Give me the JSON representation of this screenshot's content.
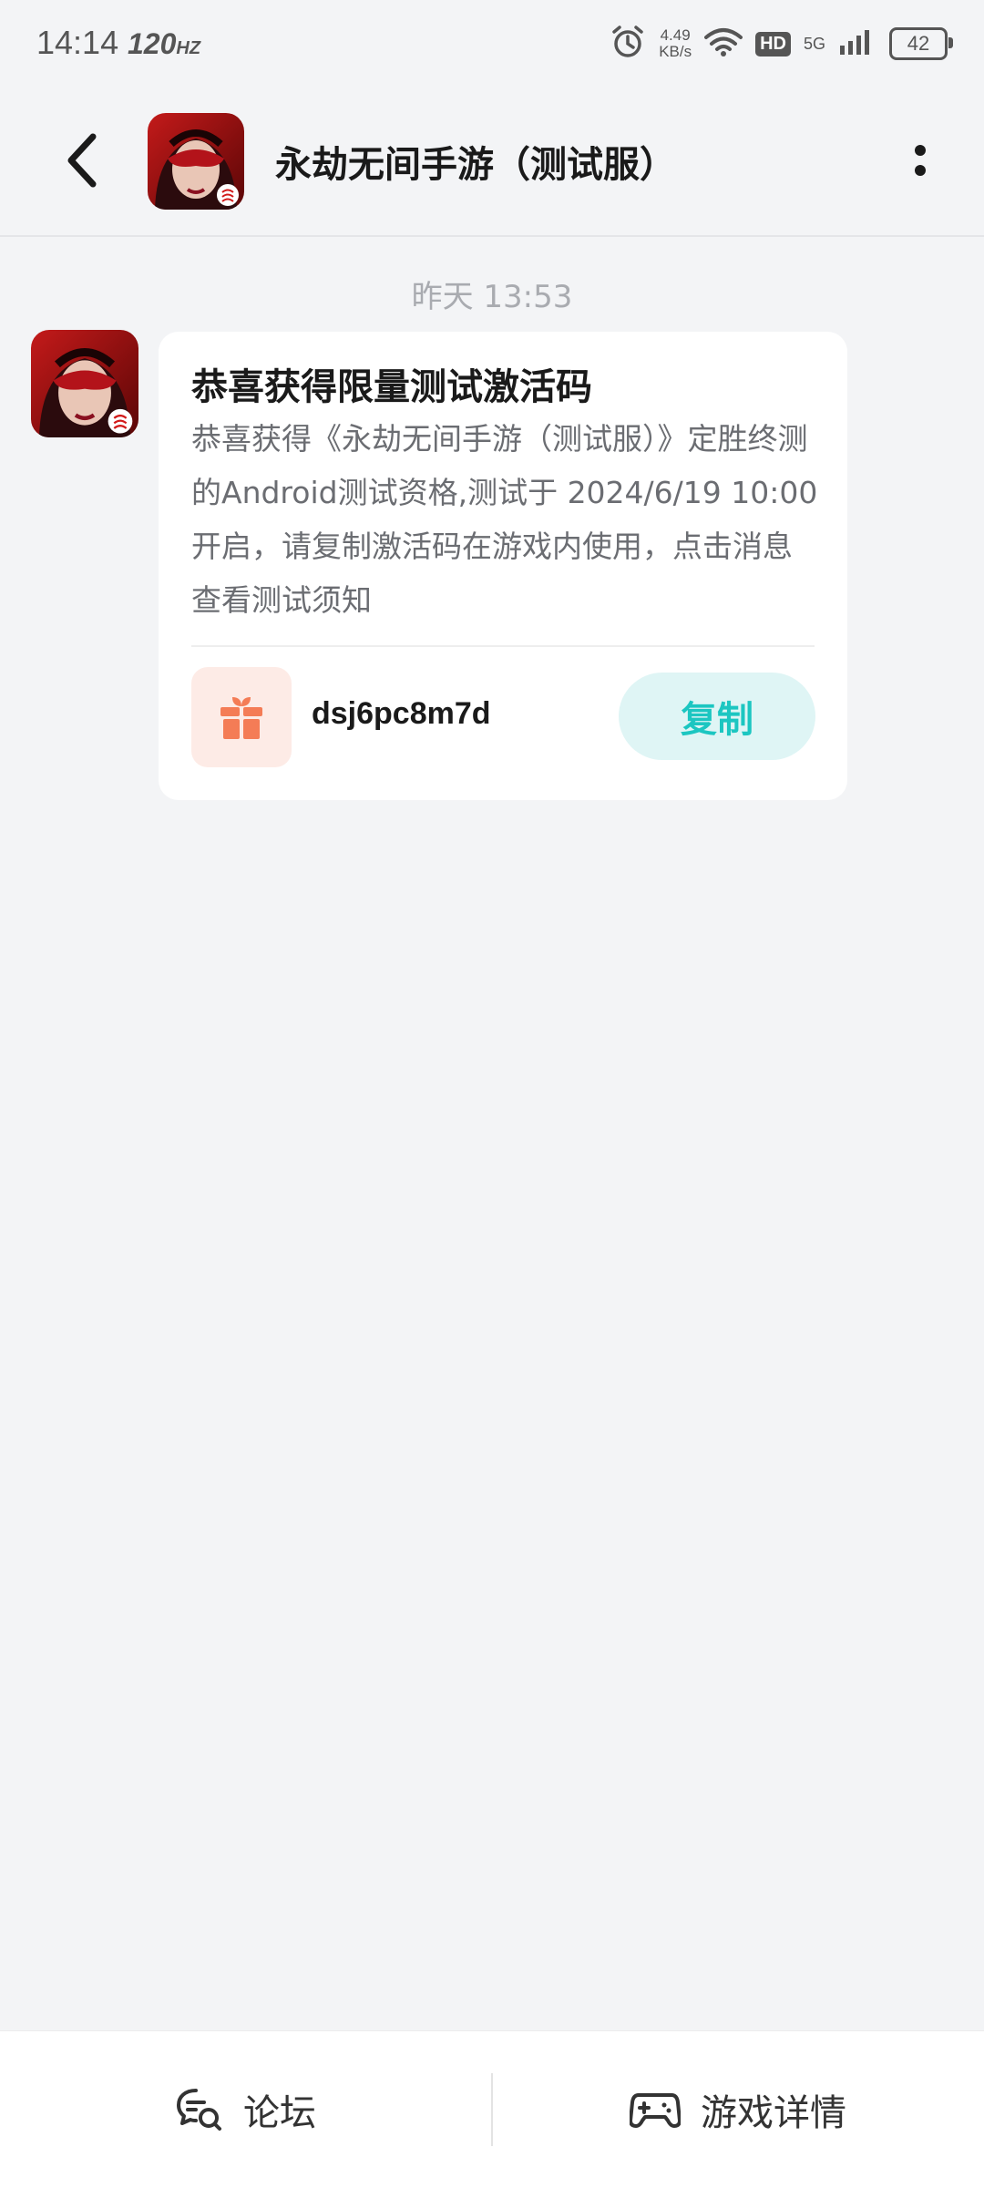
{
  "status_bar": {
    "time": "14:14",
    "refresh_rate": "120",
    "refresh_unit": "HZ",
    "net_speed_value": "4.49",
    "net_speed_unit": "KB/s",
    "hd_label": "HD",
    "network_type": "5G",
    "battery": "42"
  },
  "header": {
    "title": "永劫无间手游（测试服）"
  },
  "chat": {
    "timestamp": "昨天  13:53",
    "message": {
      "title": "恭喜获得限量测试激活码",
      "body": "恭喜获得《永劫无间手游（测试服）》定胜终测的Android测试资格,测试于 2024/6/19 10:00 开启，请复制激活码在游戏内使用，点击消息查看测试须知",
      "code": "dsj6pc8m7d",
      "copy_label": "复制"
    }
  },
  "bottom_bar": {
    "forum_label": "论坛",
    "game_detail_label": "游戏详情"
  },
  "colors": {
    "accent": "#1cc6c1",
    "gift": "#f47c56",
    "background": "#f3f4f6"
  }
}
